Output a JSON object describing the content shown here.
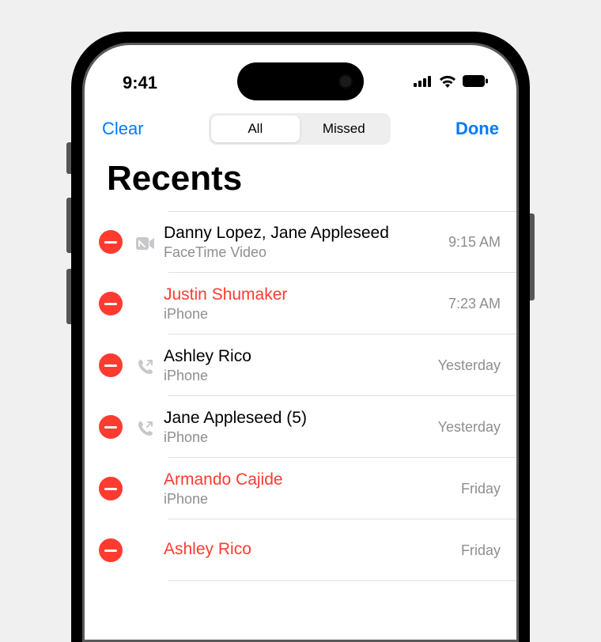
{
  "status": {
    "time": "9:41"
  },
  "nav": {
    "clear": "Clear",
    "done": "Done",
    "seg_all": "All",
    "seg_missed": "Missed"
  },
  "title": "Recents",
  "calls": [
    {
      "name": "Danny Lopez, Jane Appleseed",
      "sub": "FaceTime Video",
      "time": "9:15 AM",
      "missed": false,
      "icon": "video"
    },
    {
      "name": "Justin Shumaker",
      "sub": "iPhone",
      "time": "7:23 AM",
      "missed": true,
      "icon": "none"
    },
    {
      "name": "Ashley Rico",
      "sub": "iPhone",
      "time": "Yesterday",
      "missed": false,
      "icon": "outgoing"
    },
    {
      "name": "Jane Appleseed (5)",
      "sub": "iPhone",
      "time": "Yesterday",
      "missed": false,
      "icon": "outgoing"
    },
    {
      "name": "Armando Cajide",
      "sub": "iPhone",
      "time": "Friday",
      "missed": true,
      "icon": "none"
    },
    {
      "name": "Ashley Rico",
      "sub": "",
      "time": "Friday",
      "missed": true,
      "icon": "none"
    }
  ]
}
